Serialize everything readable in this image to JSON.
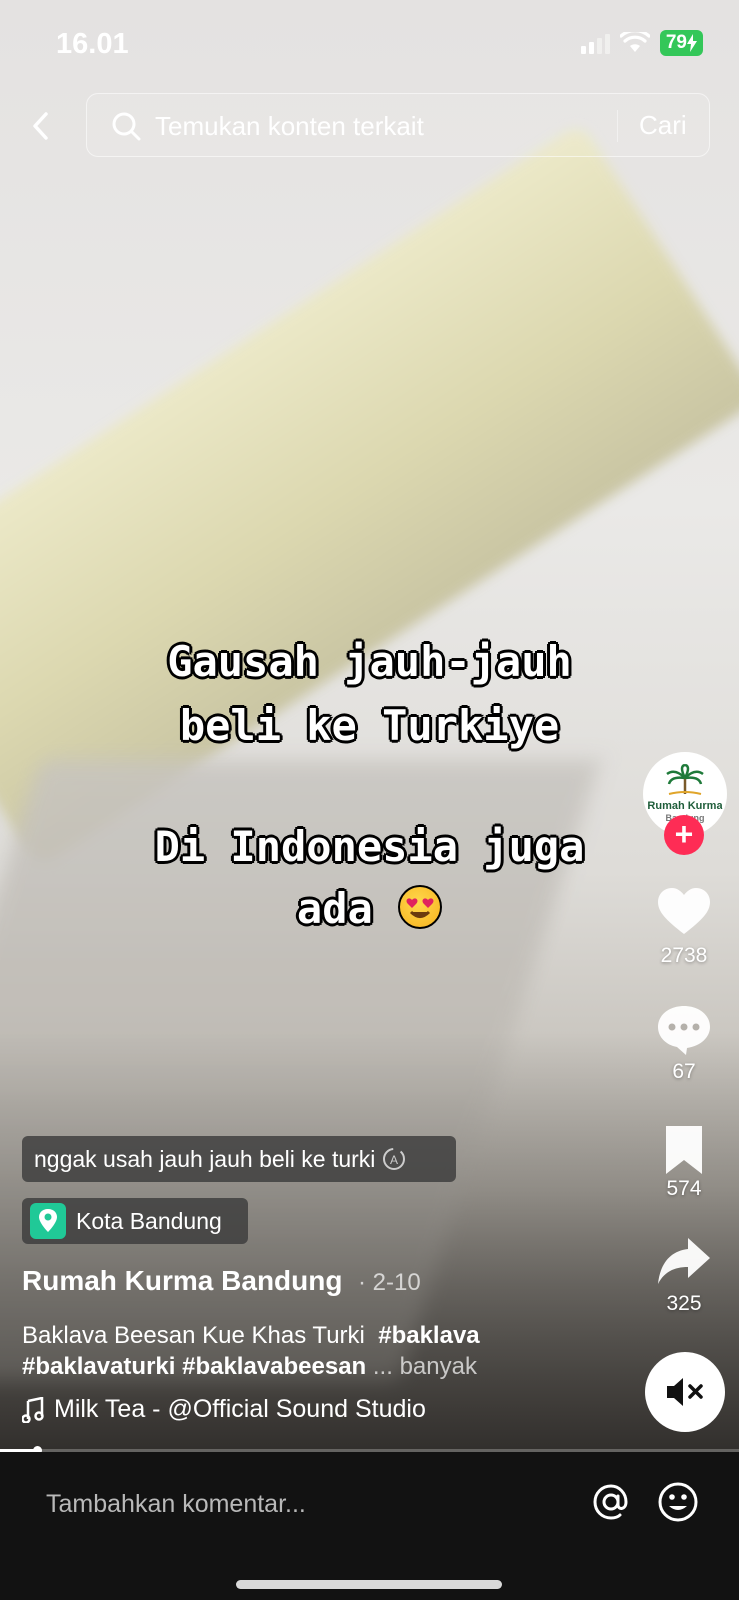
{
  "status_bar": {
    "time": "16.01",
    "battery": "79"
  },
  "search": {
    "placeholder": "Temukan konten terkait",
    "submit_label": "Cari"
  },
  "overlay": {
    "line1": "Gausah jauh-jauh",
    "line2": "beli ke Turkiye",
    "line3": "Di Indonesia juga",
    "line4": "ada"
  },
  "creator": {
    "avatar_text": "Rumah Kurma",
    "avatar_sub": "Bandung",
    "follow_label": "+"
  },
  "actions": {
    "likes": "2738",
    "comments": "67",
    "saves": "574",
    "shares": "325"
  },
  "post": {
    "translation_chip": "nggak usah jauh jauh beli ke turki",
    "location": "Kota Bandung",
    "author": "Rumah Kurma Bandung",
    "date": "· 2-10",
    "caption": "Baklava Beesan Kue Khas Turki",
    "hashtags": [
      "#baklava",
      "#baklavaturki",
      "#baklavabeesan"
    ],
    "more": "... banyak",
    "music": "Milk Tea - @Official Sound Studio"
  },
  "playback": {
    "progress": 0.05
  },
  "comment": {
    "placeholder": "Tambahkan komentar..."
  },
  "colors": {
    "accent": "#fe2c55",
    "location_icon": "#20c997",
    "battery": "#34c759"
  }
}
